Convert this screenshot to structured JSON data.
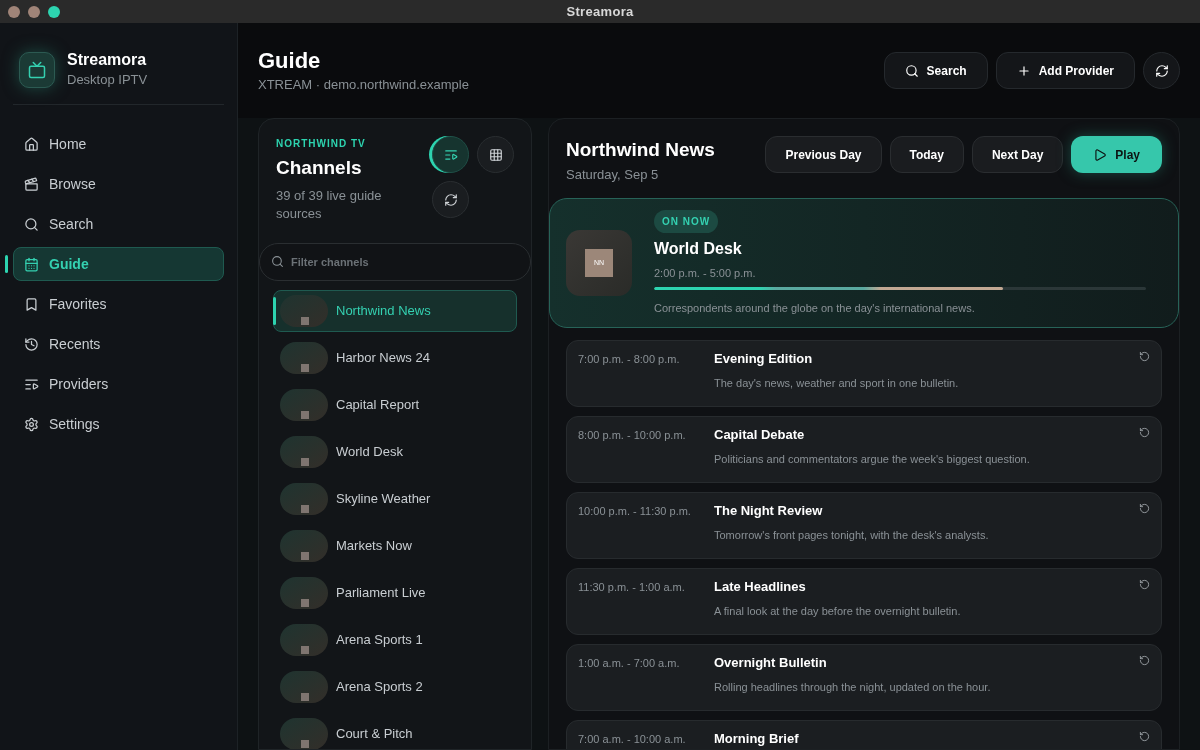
{
  "window": {
    "title": "Streamora"
  },
  "brand": {
    "name": "Streamora",
    "subtitle": "Desktop IPTV"
  },
  "sidebar": {
    "items": [
      {
        "label": "Home",
        "selected": false
      },
      {
        "label": "Browse",
        "selected": false
      },
      {
        "label": "Search",
        "selected": false
      },
      {
        "label": "Guide",
        "selected": true
      },
      {
        "label": "Favorites",
        "selected": false
      },
      {
        "label": "Recents",
        "selected": false
      },
      {
        "label": "Providers",
        "selected": false
      },
      {
        "label": "Settings",
        "selected": false
      }
    ]
  },
  "header": {
    "title": "Guide",
    "subtitle": "XTREAM · demo.northwind.example",
    "buttons": [
      "Search",
      "Add Provider"
    ]
  },
  "channels_panel": {
    "eyebrow": "NORTHWIND TV",
    "title": "Channels",
    "count": "39 of 39 live guide sources",
    "view_modes": [
      {
        "selected": true
      },
      {
        "selected": false
      }
    ],
    "filter": {
      "placeholder": "Filter channels"
    },
    "channels": [
      {
        "name": "Northwind News",
        "selected": true
      },
      {
        "name": "Harbor News 24",
        "selected": false
      },
      {
        "name": "Capital Report",
        "selected": false
      },
      {
        "name": "World Desk",
        "selected": false
      },
      {
        "name": "Skyline Weather",
        "selected": false
      },
      {
        "name": "Markets Now",
        "selected": false
      },
      {
        "name": "Parliament Live",
        "selected": false
      },
      {
        "name": "Arena Sports 1",
        "selected": false
      },
      {
        "name": "Arena Sports 2",
        "selected": false
      },
      {
        "name": "Court & Pitch",
        "selected": false
      }
    ]
  },
  "guide": {
    "channel": "Northwind News",
    "date": "Saturday, Sep 5",
    "buttons": [
      "Previous Day",
      "Today",
      "Next Day"
    ],
    "play": "Play",
    "now": {
      "badge": "ON NOW",
      "logo": "NN",
      "title": "World Desk",
      "time": "2:00 p.m. - 5:00 p.m.",
      "level": 0.71,
      "description": "Correspondents around the globe on the day's international news."
    },
    "schedule": [
      {
        "time": "7:00 p.m. - 8:00 p.m.",
        "title": "Evening Edition",
        "description": "The day's news, weather and sport in one bulletin."
      },
      {
        "time": "8:00 p.m. - 10:00 p.m.",
        "title": "Capital Debate",
        "description": "Politicians and commentators argue the week's biggest question."
      },
      {
        "time": "10:00 p.m. - 11:30 p.m.",
        "title": "The Night Review",
        "description": "Tomorrow's front pages tonight, with the desk's analysts."
      },
      {
        "time": "11:30 p.m. - 1:00 a.m.",
        "title": "Late Headlines",
        "description": "A final look at the day before the overnight bulletin."
      },
      {
        "time": "1:00 a.m. - 7:00 a.m.",
        "title": "Overnight Bulletin",
        "description": "Rolling headlines through the night, updated on the hour."
      },
      {
        "time": "7:00 a.m. - 10:00 a.m.",
        "title": "Morning Brief"
      }
    ]
  }
}
